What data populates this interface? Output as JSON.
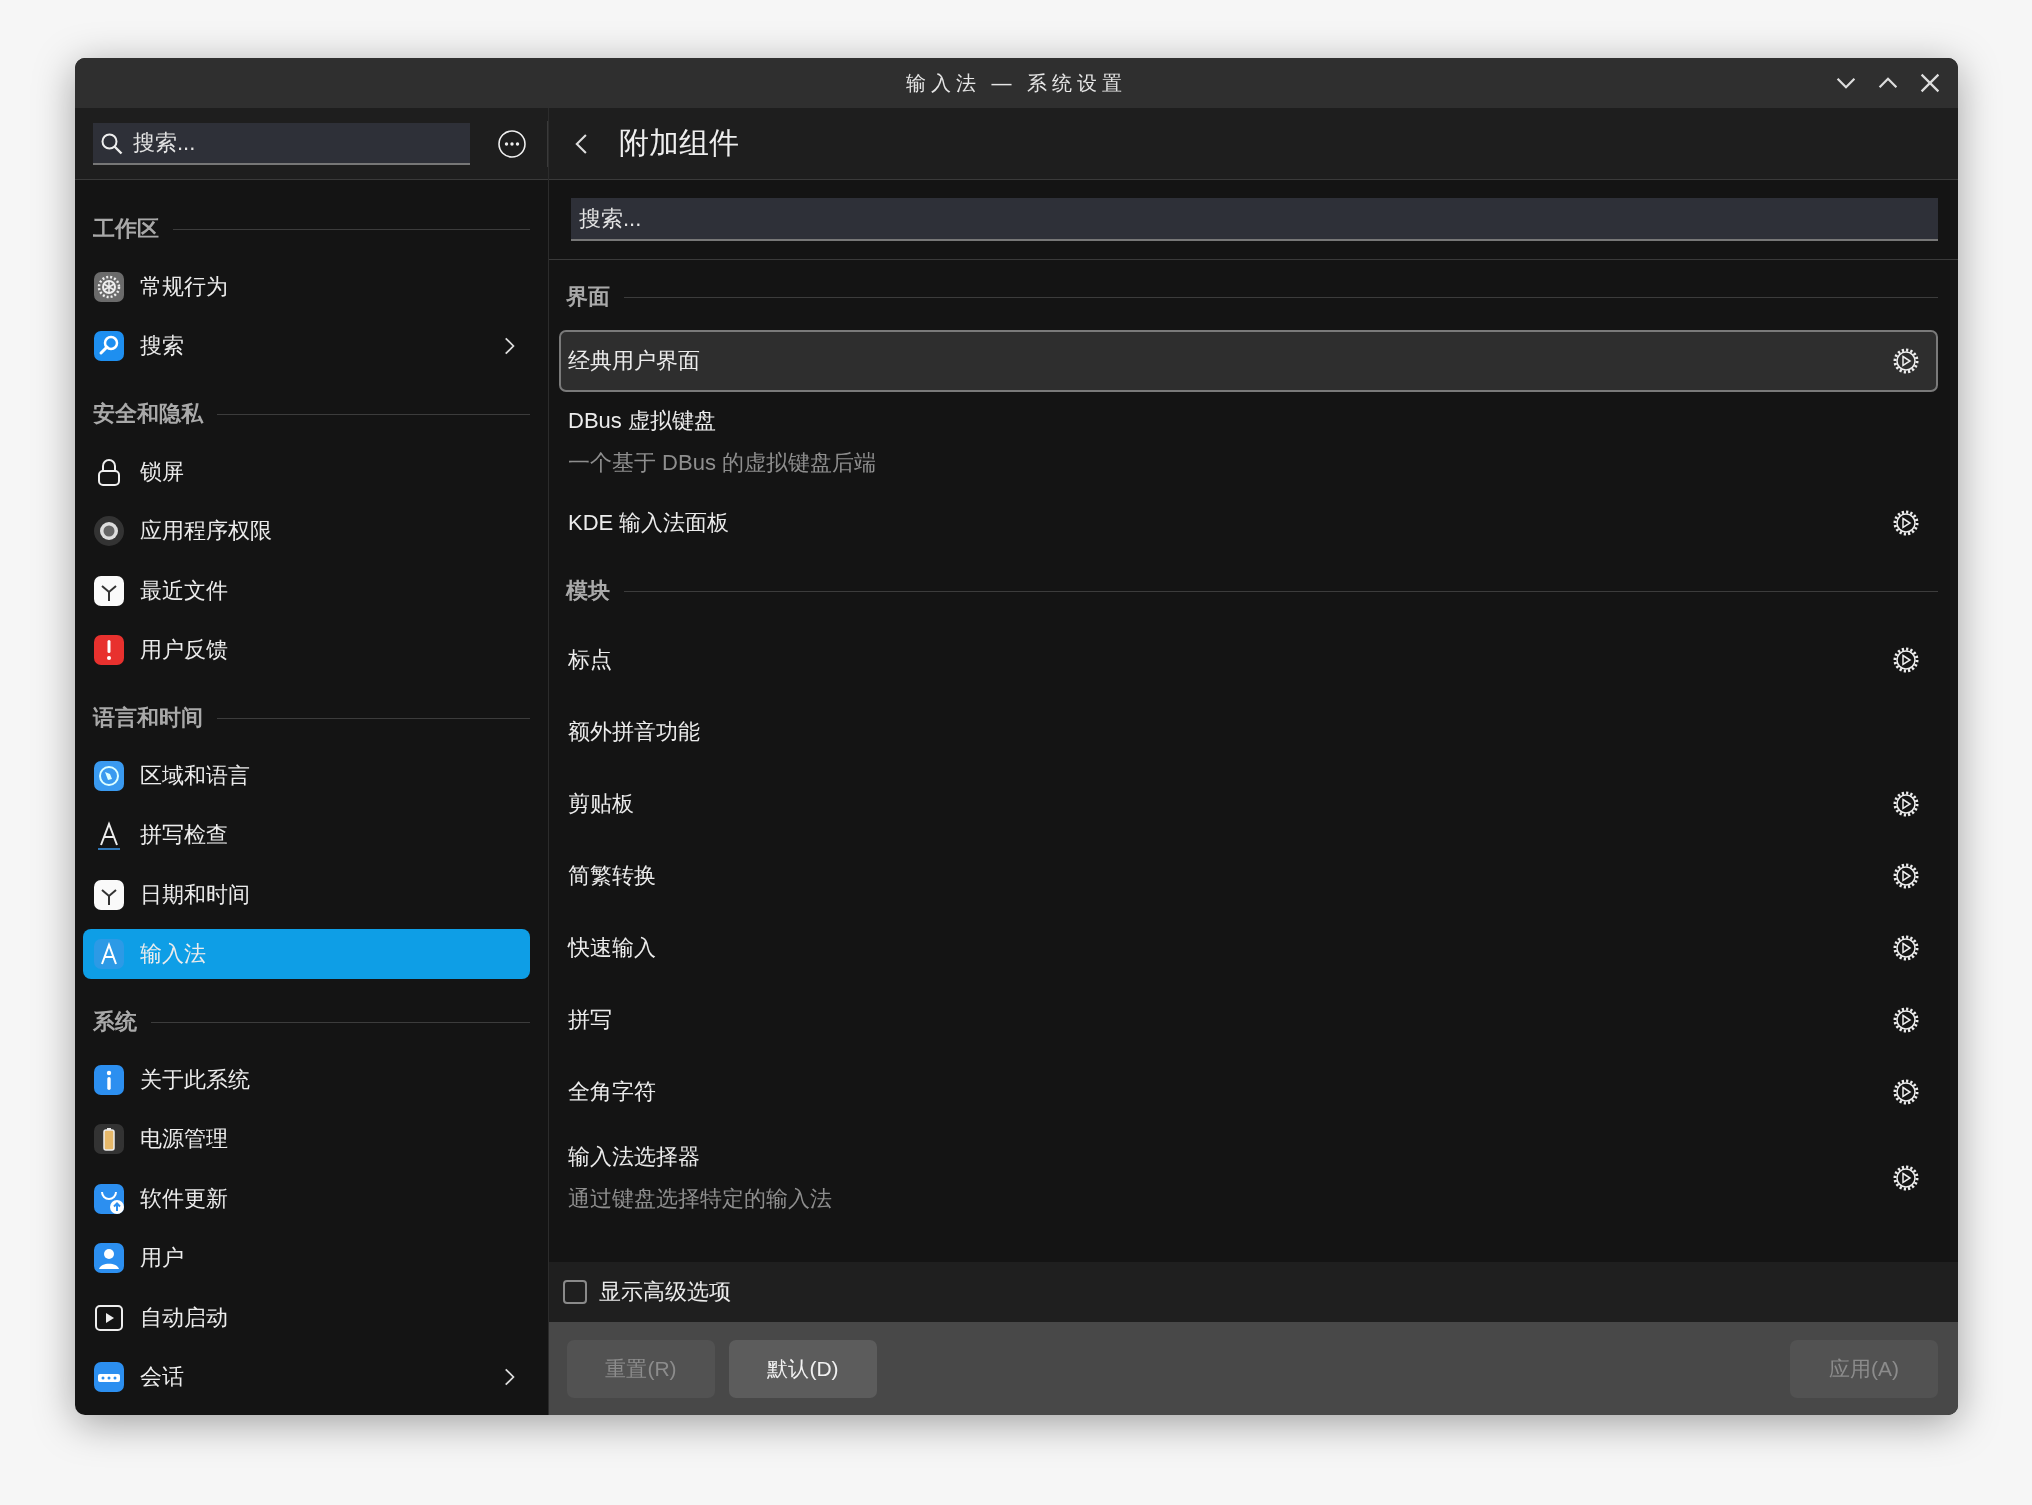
{
  "window": {
    "title": "输入法 — 系统设置"
  },
  "sidebar": {
    "search": {
      "placeholder": "搜索..."
    },
    "sections": [
      {
        "title": "工作区",
        "items": [
          {
            "label": "常规行为",
            "selected": false,
            "arrow": false
          },
          {
            "label": "搜索",
            "selected": false,
            "arrow": true
          }
        ]
      },
      {
        "title": "安全和隐私",
        "items": [
          {
            "label": "锁屏",
            "selected": false,
            "arrow": false
          },
          {
            "label": "应用程序权限",
            "selected": false,
            "arrow": false
          },
          {
            "label": "最近文件",
            "selected": false,
            "arrow": false
          },
          {
            "label": "用户反馈",
            "selected": false,
            "arrow": false
          }
        ]
      },
      {
        "title": "语言和时间",
        "items": [
          {
            "label": "区域和语言",
            "selected": false,
            "arrow": false
          },
          {
            "label": "拼写检查",
            "selected": false,
            "arrow": false
          },
          {
            "label": "日期和时间",
            "selected": false,
            "arrow": false
          },
          {
            "label": "输入法",
            "selected": true,
            "arrow": false
          }
        ]
      },
      {
        "title": "系统",
        "items": [
          {
            "label": "关于此系统",
            "selected": false,
            "arrow": false
          },
          {
            "label": "电源管理",
            "selected": false,
            "arrow": false
          },
          {
            "label": "软件更新",
            "selected": false,
            "arrow": false
          },
          {
            "label": "用户",
            "selected": false,
            "arrow": false
          },
          {
            "label": "自动启动",
            "selected": false,
            "arrow": false
          },
          {
            "label": "会话",
            "selected": false,
            "arrow": true
          }
        ]
      }
    ]
  },
  "page": {
    "title": "附加组件",
    "search": {
      "placeholder": "搜索..."
    },
    "sections": [
      {
        "title": "界面",
        "items": [
          {
            "label": "经典用户界面",
            "selected": true,
            "configurable": true
          },
          {
            "label": "DBus 虚拟键盘",
            "description": "一个基于 DBus 的虚拟键盘后端",
            "selected": false,
            "configurable": false
          },
          {
            "label": "KDE 输入法面板",
            "selected": false,
            "configurable": true
          }
        ]
      },
      {
        "title": "模块",
        "items": [
          {
            "label": "标点",
            "selected": false,
            "configurable": true
          },
          {
            "label": "额外拼音功能",
            "selected": false,
            "configurable": false
          },
          {
            "label": "剪贴板",
            "selected": false,
            "configurable": true
          },
          {
            "label": "简繁转换",
            "selected": false,
            "configurable": true
          },
          {
            "label": "快速输入",
            "selected": false,
            "configurable": true
          },
          {
            "label": "拼写",
            "selected": false,
            "configurable": true
          },
          {
            "label": "全角字符",
            "selected": false,
            "configurable": true
          },
          {
            "label": "输入法选择器",
            "description": "通过键盘选择特定的输入法",
            "selected": false,
            "configurable": true
          }
        ]
      }
    ]
  },
  "advanced": {
    "label": "显示高级选项",
    "checked": false
  },
  "buttons": [
    {
      "label": "重置(R)",
      "disabled": true
    },
    {
      "label": "默认(D)",
      "disabled": false
    },
    {
      "label": "应用(A)",
      "disabled": true
    }
  ]
}
